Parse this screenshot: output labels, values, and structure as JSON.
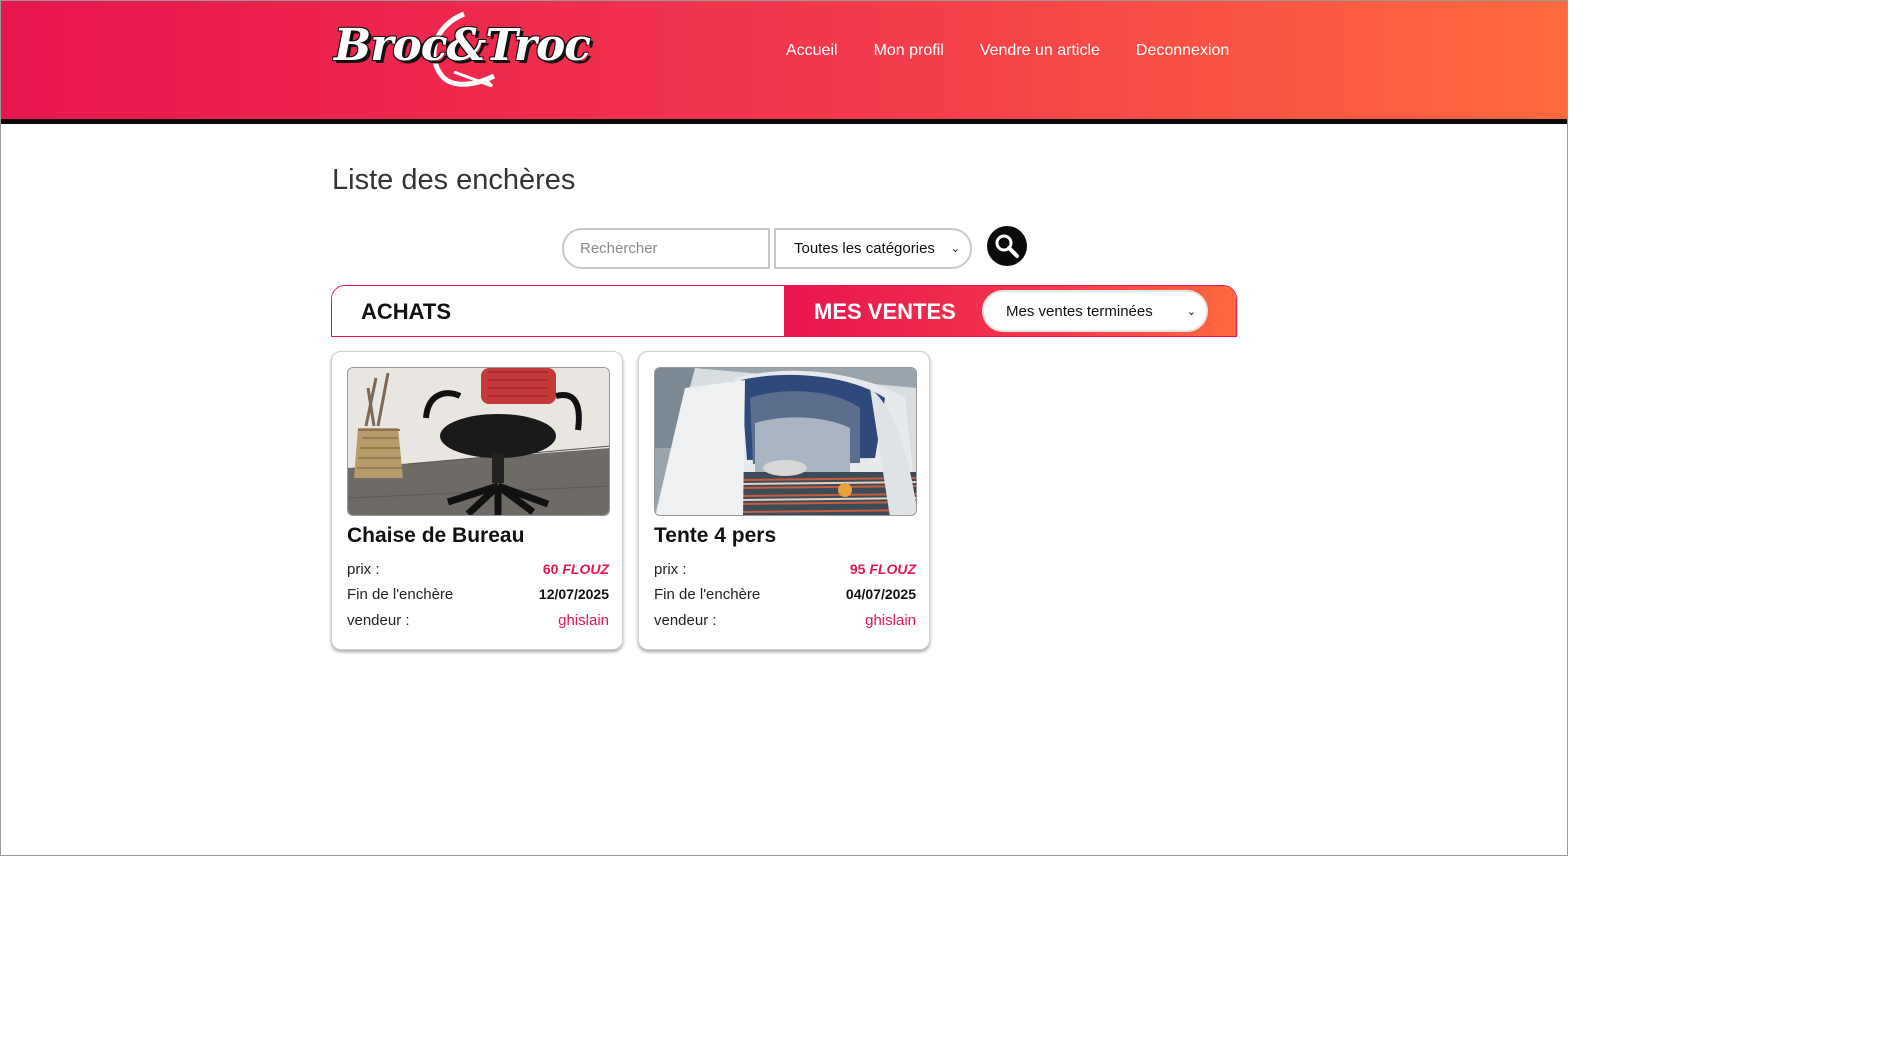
{
  "header": {
    "logo_text": "Broc&Troc",
    "nav": [
      "Accueil",
      "Mon profil",
      "Vendre un article",
      "Deconnexion"
    ]
  },
  "page_title": "Liste des enchères",
  "search": {
    "placeholder": "Rechercher",
    "category_selected": "Toutes les catégories"
  },
  "tabs": {
    "achats": "ACHATS",
    "mes_ventes": "MES VENTES",
    "sales_filter_selected": "Mes ventes terminées"
  },
  "cards": [
    {
      "title": "Chaise de Bureau",
      "price_label": "prix :",
      "price_value": "60",
      "currency": "FLOUZ",
      "end_label": "Fin de l'enchère",
      "end_date": "12/07/2025",
      "seller_label": "vendeur :",
      "seller": "ghislain",
      "image": "office-chair-photo"
    },
    {
      "title": "Tente 4 pers",
      "price_label": "prix :",
      "price_value": "95",
      "currency": "FLOUZ",
      "end_label": "Fin de l'enchère",
      "end_date": "04/07/2025",
      "seller_label": "vendeur :",
      "seller": "ghislain",
      "image": "tent-photo"
    }
  ],
  "colors": {
    "brand_pink": "#e8154e",
    "brand_orange": "#ff6a3d",
    "dark": "#0a0a0a"
  }
}
